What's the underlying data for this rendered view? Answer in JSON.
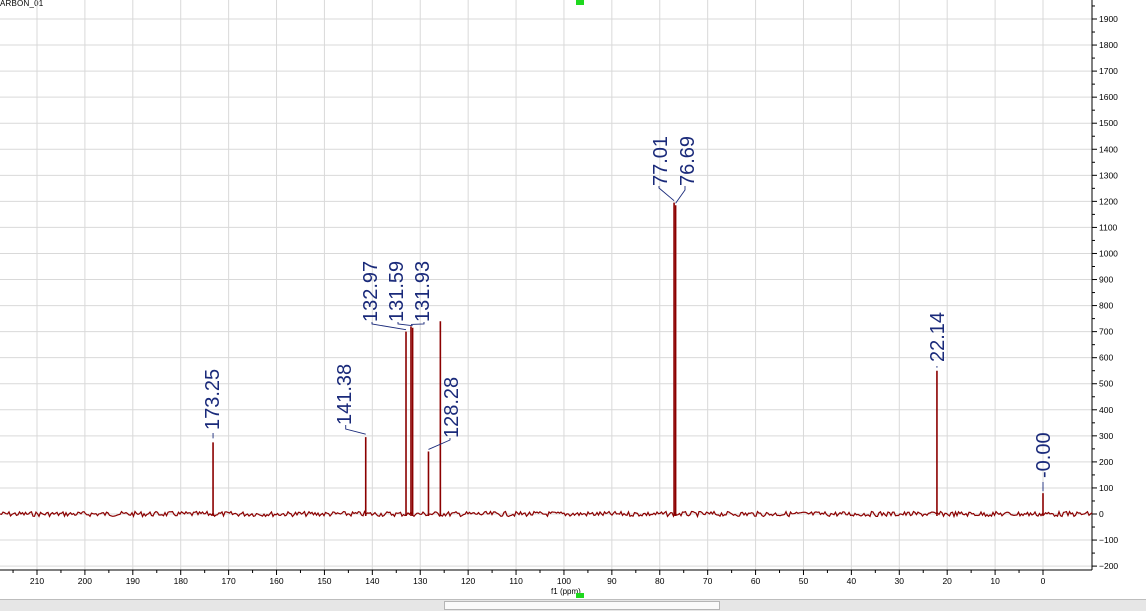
{
  "window": {
    "title": "ARBON_01"
  },
  "colors": {
    "spectrum": "#8b0000",
    "peak_label": "#1a2a7a",
    "grid": "#d9d9d9",
    "marker": "#1ed81e"
  },
  "chart_data": {
    "type": "line",
    "title": "",
    "xlabel": "f1 (ppm)",
    "ylabel": "",
    "xlim": [
      220,
      -10
    ],
    "ylim": [
      -210,
      1975
    ],
    "x_reversed": true,
    "grid": true,
    "x_ticks": [
      "210",
      "200",
      "190",
      "180",
      "170",
      "160",
      "150",
      "140",
      "130",
      "120",
      "110",
      "100",
      "90",
      "80",
      "70",
      "60",
      "50",
      "40",
      "30",
      "20",
      "10",
      "0"
    ],
    "y_ticks": [
      "1900",
      "1800",
      "1700",
      "1600",
      "1500",
      "1400",
      "1300",
      "1200",
      "1100",
      "1000",
      "900",
      "800",
      "700",
      "600",
      "500",
      "400",
      "300",
      "200",
      "100",
      "0",
      "-100",
      "-200"
    ],
    "peaks": [
      {
        "ppm": 173.25,
        "label": "173.25",
        "height": 275
      },
      {
        "ppm": 141.38,
        "label": "141.38",
        "height": 295
      },
      {
        "ppm": 132.97,
        "label": "132.97",
        "height": 700
      },
      {
        "ppm": 131.93,
        "label": "131.93",
        "height": 720
      },
      {
        "ppm": 131.59,
        "label": "131.59",
        "height": 715
      },
      {
        "ppm": 128.28,
        "label": "128.28",
        "height": 240
      },
      {
        "ppm": 125.8,
        "label": "",
        "height": 740
      },
      {
        "ppm": 77.01,
        "label": "77.01",
        "height": 1195
      },
      {
        "ppm": 76.69,
        "label": "76.69",
        "height": 1185
      },
      {
        "ppm": 22.14,
        "label": "22.14",
        "height": 550
      },
      {
        "ppm": 0.0,
        "label": "-0.00",
        "height": 80
      }
    ]
  }
}
